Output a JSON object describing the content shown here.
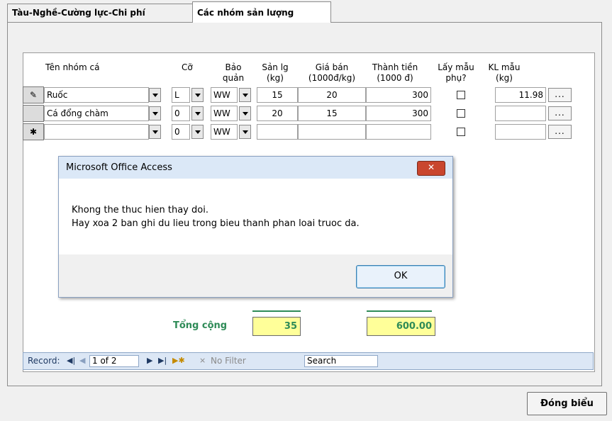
{
  "tabs": [
    {
      "label": "Tàu-Nghề-Cường lực-Chi phí"
    },
    {
      "label": "Các nhóm sản lượng"
    }
  ],
  "grid": {
    "headers": {
      "ten_nhom": "Tên nhóm cá",
      "co": "Cỡ",
      "bao_quan": "Bảo\nquản",
      "san_lg": "Sản lg\n(kg)",
      "gia_ban": "Giá bán\n(1000đ/kg)",
      "thanh_tien": "Thành tiền\n(1000 đ)",
      "lay_mau": "Lấy mẫu\nphụ?",
      "kl_mau": "KL mẫu\n(kg)"
    },
    "rows": [
      {
        "selector": "✎",
        "ten_nhom": "Ruốc",
        "co": "L",
        "bao_quan": "WW",
        "san_lg": "15",
        "gia_ban": "20",
        "thanh_tien": "300",
        "lay_mau": false,
        "kl_mau": "11.98",
        "btn": "..."
      },
      {
        "selector": "",
        "ten_nhom": "Cá đổng chàm",
        "co": "0",
        "bao_quan": "WW",
        "san_lg": "20",
        "gia_ban": "15",
        "thanh_tien": "300",
        "lay_mau": false,
        "kl_mau": "",
        "btn": "..."
      },
      {
        "selector": "✱",
        "ten_nhom": "",
        "co": "0",
        "bao_quan": "WW",
        "san_lg": "",
        "gia_ban": "",
        "thanh_tien": "",
        "lay_mau": false,
        "kl_mau": "",
        "btn": "..."
      }
    ]
  },
  "totals": {
    "label": "Tổng cộng",
    "san_lg": "35",
    "thanh_tien": "600.00"
  },
  "record_nav": {
    "label": "Record:",
    "first": "◀|",
    "prev": "◀",
    "position": "1 of 2",
    "next": "▶",
    "last": "▶|",
    "new": "▶✱",
    "filter": "No Filter",
    "search": "Search"
  },
  "close_button": "Đóng biểu",
  "dialog": {
    "title": "Microsoft Office Access",
    "close": "✕",
    "message_line1": "Khong the thuc hien thay doi.",
    "message_line2": "Hay xoa 2 ban ghi du lieu trong bieu thanh phan loai truoc da.",
    "ok": "OK"
  }
}
